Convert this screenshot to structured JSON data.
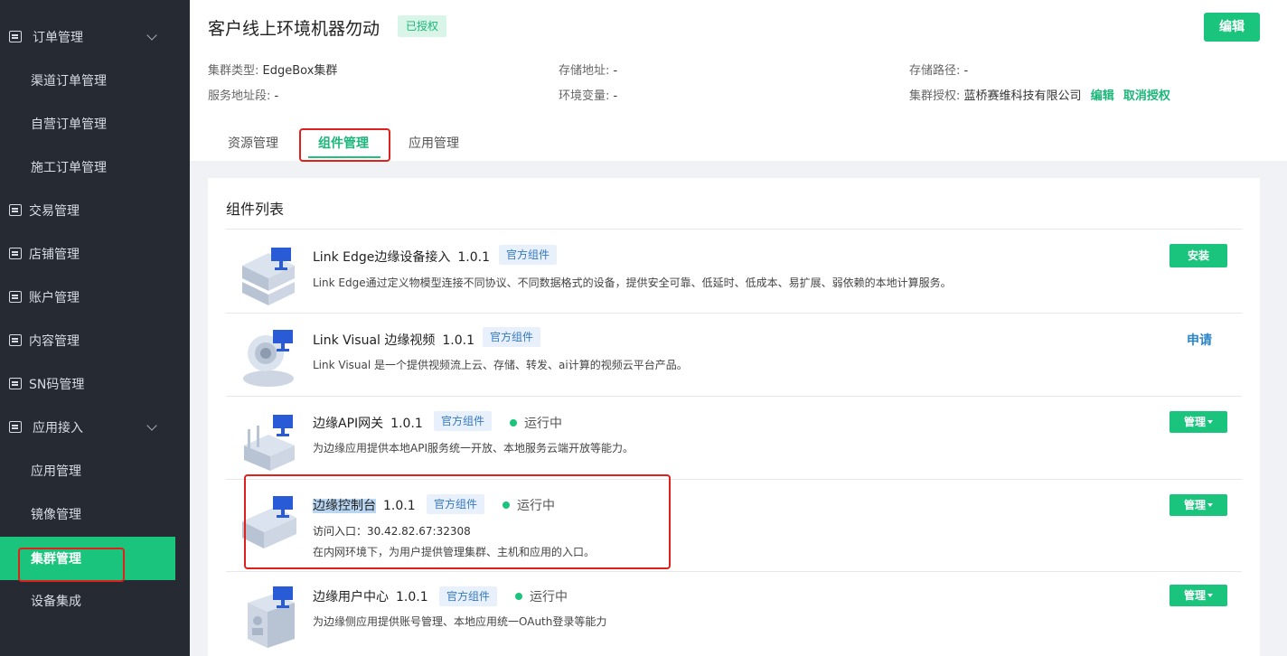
{
  "sidebar": {
    "items": [
      {
        "label": "订单管理",
        "icon": "list-icon"
      },
      {
        "label": "渠道订单管理"
      },
      {
        "label": "自营订单管理"
      },
      {
        "label": "施工订单管理"
      },
      {
        "label": "交易管理",
        "icon": "transaction-icon"
      },
      {
        "label": "店铺管理",
        "icon": "store-icon"
      },
      {
        "label": "账户管理",
        "icon": "account-icon"
      },
      {
        "label": "内容管理",
        "icon": "content-icon"
      },
      {
        "label": "SN码管理",
        "icon": "sn-icon"
      },
      {
        "label": "应用接入",
        "icon": "app-icon"
      },
      {
        "label": "应用管理"
      },
      {
        "label": "镜像管理"
      },
      {
        "label": "集群管理"
      },
      {
        "label": "设备集成"
      }
    ]
  },
  "header": {
    "title": "客户线上环境机器勿动",
    "badge": "已授权",
    "edit_label": "编辑",
    "meta": {
      "cluster_type_key": "集群类型:",
      "cluster_type_val": "EdgeBox集群",
      "storage_addr_key": "存储地址:",
      "storage_addr_val": "-",
      "storage_path_key": "存储路径:",
      "storage_path_val": "-",
      "service_range_key": "服务地址段:",
      "service_range_val": "-",
      "env_key": "环境变量:",
      "env_val": "-",
      "auth_key": "集群授权:",
      "auth_val": "蓝桥赛维科技有限公司",
      "auth_edit": "编辑",
      "auth_cancel": "取消授权"
    },
    "tabs": [
      "资源管理",
      "组件管理",
      "应用管理"
    ]
  },
  "list": {
    "title": "组件列表",
    "components": [
      {
        "name": "Link Edge边缘设备接入",
        "version": "1.0.1",
        "tag": "官方组件",
        "desc": "Link Edge通过定义物模型连接不同协议、不同数据格式的设备，提供安全可靠、低延时、低成本、易扩展、弱依赖的本地计算服务。",
        "action": "安装"
      },
      {
        "name": "Link Visual 边缘视频",
        "version": "1.0.1",
        "tag": "官方组件",
        "desc": "Link Visual 是一个提供视频流上云、存储、转发、ai计算的视频云平台产品。",
        "action": "申请"
      },
      {
        "name": "边缘API网关",
        "version": "1.0.1",
        "tag": "官方组件",
        "status": "运行中",
        "desc": "为边缘应用提供本地API服务统一开放、本地服务云端开放等能力。",
        "action": "管理"
      },
      {
        "name": "边缘控制台",
        "version": "1.0.1",
        "tag": "官方组件",
        "status": "运行中",
        "entry": "访问入口：30.42.82.67:32308",
        "desc": "在内网环境下，为用户提供管理集群、主机和应用的入口。",
        "action": "管理"
      },
      {
        "name": "边缘用户中心",
        "version": "1.0.1",
        "tag": "官方组件",
        "status": "运行中",
        "desc": "为边缘侧应用提供账号管理、本地应用统一OAuth登录等能力",
        "action": "管理"
      }
    ]
  },
  "colors": {
    "accent": "#1bc47d",
    "sidebar_bg": "#252a33",
    "link_blue": "#2b86c9",
    "highlight_red": "#e0201c"
  }
}
